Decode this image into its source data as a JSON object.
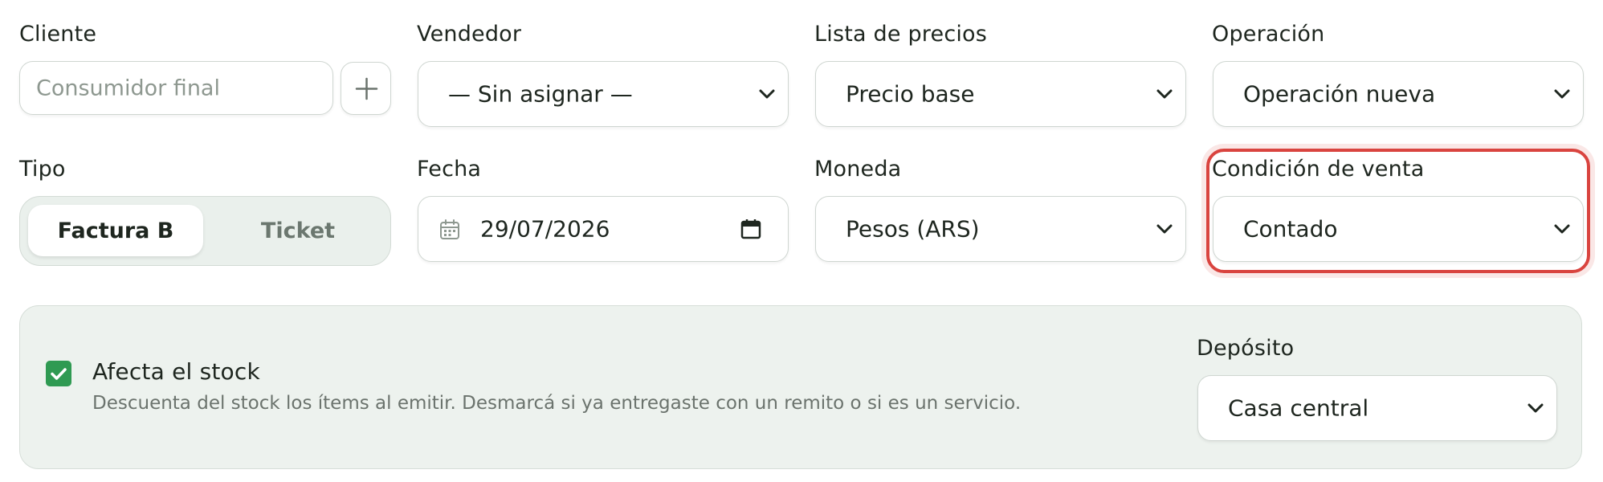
{
  "cliente": {
    "label": "Cliente",
    "placeholder": "Consumidor final",
    "add_icon": "plus-icon"
  },
  "vendedor": {
    "label": "Vendedor",
    "value": "— Sin asignar —"
  },
  "lista_precios": {
    "label": "Lista de precios",
    "value": "Precio base"
  },
  "operacion": {
    "label": "Operación",
    "value": "Operación nueva"
  },
  "tipo": {
    "label": "Tipo",
    "options": [
      "Factura B",
      "Ticket"
    ],
    "selected": "Factura B"
  },
  "fecha": {
    "label": "Fecha",
    "value": "29/07/2026",
    "icon_left": "calendar-icon",
    "icon_right": "calendar-picker-icon"
  },
  "moneda": {
    "label": "Moneda",
    "value": "Pesos (ARS)"
  },
  "condicion_venta": {
    "label": "Condición de venta",
    "value": "Contado",
    "highlight_color": "#d9443f"
  },
  "stock": {
    "checked": true,
    "label": "Afecta el stock",
    "description": "Descuenta del stock los ítems al emitir. Desmarcá si ya entregaste con un remito o si es un servicio.",
    "check_color": "#2f9a52"
  },
  "deposito": {
    "label": "Depósito",
    "value": "Casa central"
  }
}
